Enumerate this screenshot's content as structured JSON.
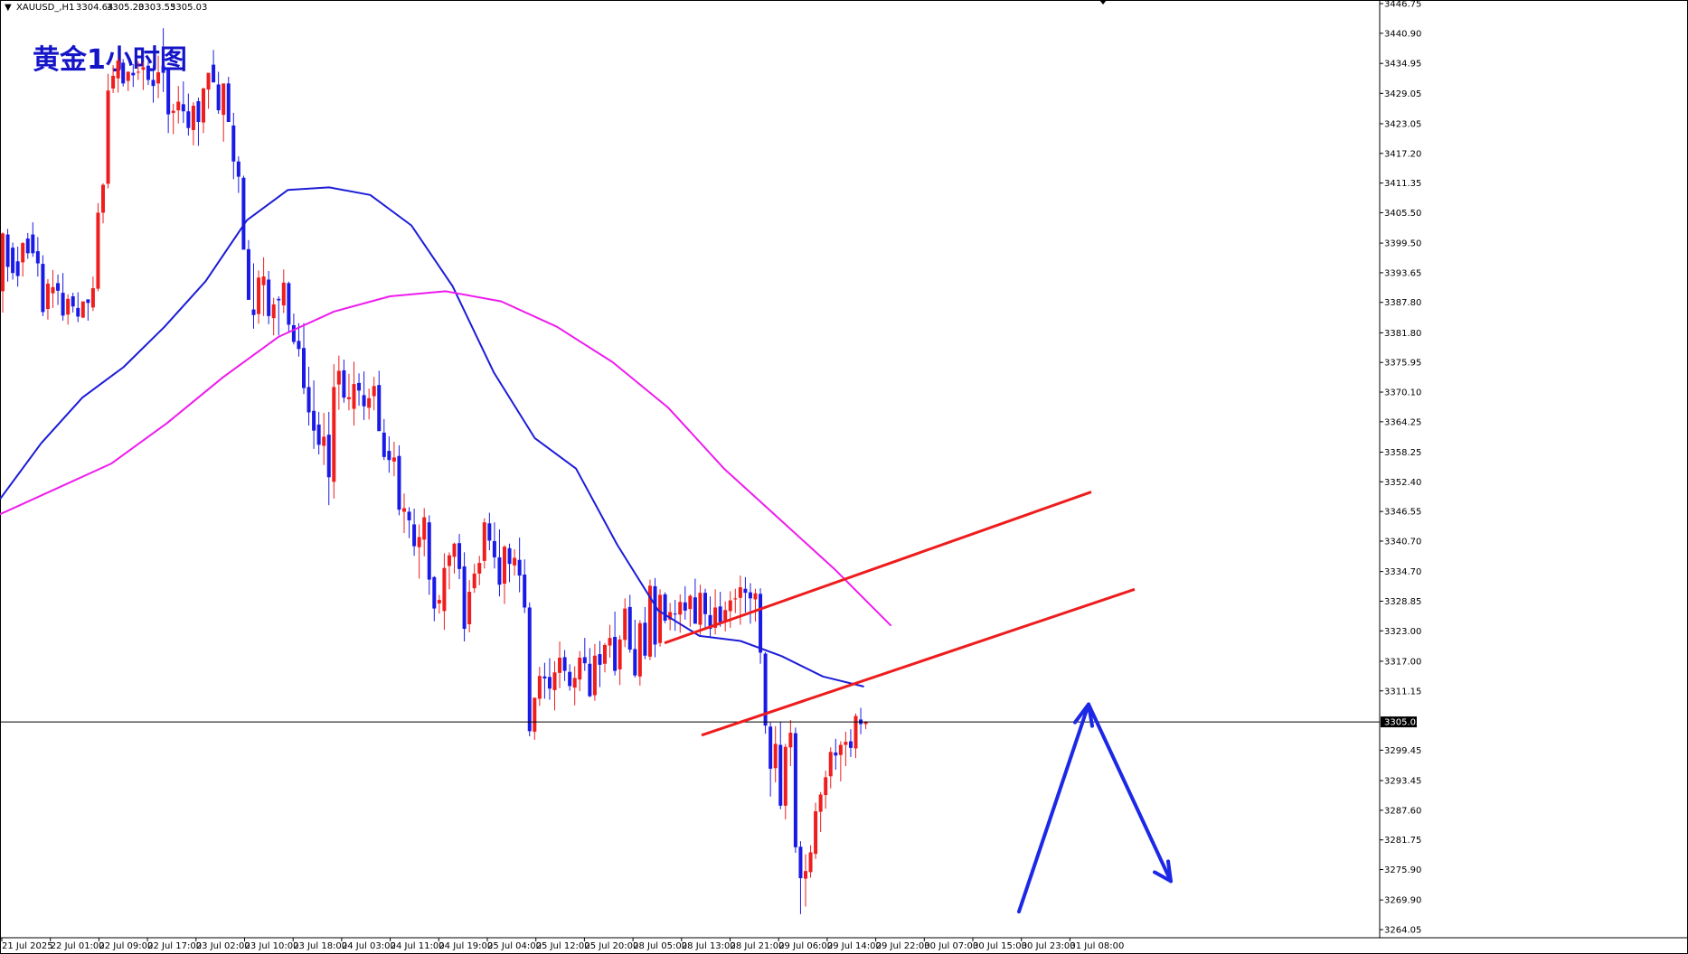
{
  "symbol_info": {
    "symbol": "XAUUSD_,H1",
    "open": "3304.64",
    "high": "3305.20",
    "low": "3303.55",
    "close": "3305.03"
  },
  "overlay_title": "黄金1小时图",
  "current_price_label": "3305.03",
  "colors": {
    "bull": "#ef1d1d",
    "bear": "#1a1ae6",
    "ma_fast": "#1c1cd8",
    "ma_slow": "#ee1cee",
    "channel": "#ee1c1c",
    "projection": "#1c28e6"
  },
  "chart_data": {
    "type": "candlestick",
    "timeframe": "H1",
    "ylim": [
      3264.05,
      3446.75
    ],
    "y_ticks": [
      "3446.75",
      "3440.90",
      "3434.95",
      "3429.05",
      "3423.05",
      "3417.20",
      "3411.35",
      "3405.50",
      "3399.50",
      "3393.65",
      "3387.80",
      "3381.80",
      "3375.95",
      "3370.10",
      "3364.25",
      "3358.25",
      "3352.40",
      "3346.55",
      "3340.70",
      "3334.70",
      "3328.85",
      "3323.00",
      "3317.00",
      "3311.15",
      "3305.03",
      "3299.45",
      "3293.45",
      "3287.60",
      "3281.75",
      "3275.90",
      "3269.90",
      "3264.05"
    ],
    "x_labels": [
      "21 Jul 2025",
      "22 Jul 01:00",
      "22 Jul 09:00",
      "22 Jul 17:00",
      "23 Jul 02:00",
      "23 Jul 10:00",
      "23 Jul 18:00",
      "24 Jul 03:00",
      "24 Jul 11:00",
      "24 Jul 19:00",
      "25 Jul 04:00",
      "25 Jul 12:00",
      "25 Jul 20:00",
      "28 Jul 05:00",
      "28 Jul 13:00",
      "28 Jul 21:00",
      "29 Jul 06:00",
      "29 Jul 14:00",
      "29 Jul 22:00",
      "30 Jul 07:00",
      "30 Jul 15:00",
      "30 Jul 23:00",
      "31 Jul 08:00"
    ],
    "candles": [
      [
        3390.0,
        3401.6,
        3385.8,
        3401.4
      ],
      [
        3401.2,
        3402.3,
        3391.9,
        3394.8
      ],
      [
        3398.6,
        3399.6,
        3392.3,
        3393.6
      ],
      [
        3395.9,
        3398.8,
        3390.9,
        3393.0
      ],
      [
        3395.7,
        3399.7,
        3392.9,
        3399.5
      ],
      [
        3400.4,
        3401.5,
        3396.4,
        3397.5
      ],
      [
        3401.2,
        3403.6,
        3396.8,
        3397.5
      ],
      [
        3397.9,
        3400.7,
        3392.9,
        3395.5
      ],
      [
        3395.4,
        3397.1,
        3385.1,
        3385.9
      ],
      [
        3386.5,
        3392.4,
        3384.4,
        3391.5
      ],
      [
        3389.6,
        3394.2,
        3386.7,
        3390.8
      ],
      [
        3391.6,
        3393.3,
        3387.3,
        3390.1
      ],
      [
        3389.7,
        3393.6,
        3384.2,
        3385.2
      ],
      [
        3385.4,
        3389.4,
        3383.4,
        3388.5
      ],
      [
        3389.0,
        3389.7,
        3385.8,
        3387.0
      ],
      [
        3386.7,
        3389.8,
        3383.9,
        3385.0
      ],
      [
        3384.8,
        3387.8,
        3384.7,
        3388.0
      ],
      [
        3388.4,
        3388.4,
        3384.2,
        3387.7
      ],
      [
        3386.8,
        3392.9,
        3386.1,
        3390.6
      ],
      [
        3390.5,
        3407.4,
        3390.0,
        3405.5
      ],
      [
        3405.5,
        3411.3,
        3403.4,
        3411.0
      ],
      [
        3411.2,
        3432.9,
        3410.3,
        3429.6
      ],
      [
        3430.0,
        3434.6,
        3429.1,
        3432.5
      ],
      [
        3432.0,
        3436.1,
        3429.2,
        3435.5
      ],
      [
        3435.1,
        3435.8,
        3430.4,
        3431.0
      ],
      [
        3431.5,
        3433.4,
        3429.5,
        3433.3
      ],
      [
        3433.1,
        3434.8,
        3430.3,
        3432.6
      ],
      [
        3433.3,
        3435.4,
        3431.7,
        3433.3
      ],
      [
        3433.7,
        3435.2,
        3429.7,
        3434.2
      ],
      [
        3434.5,
        3435.3,
        3430.7,
        3431.7
      ],
      [
        3431.7,
        3434.6,
        3427.2,
        3430.5
      ],
      [
        3431.0,
        3436.5,
        3428.1,
        3433.2
      ],
      [
        3434.5,
        3441.9,
        3429.3,
        3433.1
      ],
      [
        3433.8,
        3434.0,
        3421.2,
        3424.9
      ],
      [
        3425.2,
        3427.0,
        3421.0,
        3425.6
      ],
      [
        3425.7,
        3430.5,
        3423.1,
        3427.4
      ],
      [
        3426.9,
        3431.4,
        3423.2,
        3425.5
      ],
      [
        3425.5,
        3429.0,
        3420.7,
        3422.2
      ],
      [
        3421.8,
        3427.3,
        3418.8,
        3426.6
      ],
      [
        3427.5,
        3428.2,
        3418.7,
        3423.4
      ],
      [
        3423.3,
        3430.2,
        3421.2,
        3430.0
      ],
      [
        3429.8,
        3432.4,
        3426.0,
        3433.1
      ],
      [
        3434.7,
        3437.6,
        3431.5,
        3431.2
      ],
      [
        3430.8,
        3433.3,
        3425.0,
        3425.7
      ],
      [
        3424.8,
        3430.8,
        3419.5,
        3431.0
      ],
      [
        3431.0,
        3432.3,
        3423.6,
        3423.4
      ],
      [
        3422.7,
        3425.2,
        3412.1,
        3415.6
      ],
      [
        3415.6,
        3416.6,
        3409.4,
        3412.6
      ],
      [
        3412.4,
        3412.8,
        3401.2,
        3398.2
      ],
      [
        3398.3,
        3400.1,
        3388.8,
        3388.3
      ],
      [
        3386.4,
        3395.5,
        3382.6,
        3385.3
      ],
      [
        3385.5,
        3394.1,
        3383.6,
        3392.7
      ],
      [
        3391.2,
        3396.7,
        3385.1,
        3392.9
      ],
      [
        3392.3,
        3394.0,
        3383.5,
        3385.1
      ],
      [
        3384.7,
        3388.7,
        3381.3,
        3387.4
      ],
      [
        3388.5,
        3389.0,
        3381.3,
        3388.2
      ],
      [
        3387.2,
        3394.3,
        3385.7,
        3391.7
      ],
      [
        3391.6,
        3391.9,
        3381.8,
        3383.4
      ],
      [
        3383.3,
        3385.6,
        3379.5,
        3380.0
      ],
      [
        3380.2,
        3383.7,
        3377.1,
        3378.6
      ],
      [
        3378.8,
        3383.7,
        3369.7,
        3370.9
      ],
      [
        3371.1,
        3375.1,
        3363.5,
        3366.1
      ],
      [
        3366.4,
        3372.4,
        3358.9,
        3362.5
      ],
      [
        3363.7,
        3366.2,
        3357.8,
        3359.7
      ],
      [
        3359.5,
        3366.0,
        3355.7,
        3361.3
      ],
      [
        3361.7,
        3366.2,
        3347.8,
        3353.3
      ],
      [
        3352.4,
        3375.6,
        3349.1,
        3371.1
      ],
      [
        3371.6,
        3377.3,
        3366.6,
        3374.3
      ],
      [
        3374.4,
        3376.5,
        3368.0,
        3369.0
      ],
      [
        3368.7,
        3373.7,
        3366.5,
        3369.1
      ],
      [
        3366.8,
        3376.1,
        3363.5,
        3371.7
      ],
      [
        3371.9,
        3373.8,
        3367.4,
        3370.4
      ],
      [
        3369.5,
        3374.2,
        3364.6,
        3367.3
      ],
      [
        3367.0,
        3370.8,
        3364.7,
        3368.9
      ],
      [
        3369.3,
        3373.1,
        3366.5,
        3371.3
      ],
      [
        3371.5,
        3374.3,
        3364.5,
        3362.4
      ],
      [
        3362.1,
        3364.8,
        3356.7,
        3357.3
      ],
      [
        3358.5,
        3361.4,
        3354.2,
        3356.7
      ],
      [
        3356.4,
        3360.3,
        3353.5,
        3357.2
      ],
      [
        3357.5,
        3359.6,
        3345.8,
        3346.9
      ],
      [
        3346.5,
        3350.1,
        3342.3,
        3347.2
      ],
      [
        3346.5,
        3347.4,
        3341.3,
        3344.8
      ],
      [
        3344.0,
        3347.1,
        3337.8,
        3339.7
      ],
      [
        3339.5,
        3344.0,
        3333.3,
        3341.5
      ],
      [
        3341.0,
        3347.2,
        3337.7,
        3345.4
      ],
      [
        3344.4,
        3345.8,
        3330.1,
        3333.1
      ],
      [
        3333.6,
        3333.8,
        3324.9,
        3327.4
      ],
      [
        3328.4,
        3330.1,
        3326.4,
        3329.1
      ],
      [
        3326.9,
        3338.3,
        3323.2,
        3335.4
      ],
      [
        3335.8,
        3338.5,
        3331.2,
        3337.9
      ],
      [
        3337.6,
        3340.4,
        3334.3,
        3340.2
      ],
      [
        3340.3,
        3342.1,
        3333.2,
        3335.2
      ],
      [
        3335.7,
        3338.5,
        3320.9,
        3323.4
      ],
      [
        3324.3,
        3333.0,
        3322.7,
        3330.7
      ],
      [
        3331.4,
        3336.2,
        3330.5,
        3334.3
      ],
      [
        3334.3,
        3337.8,
        3332.0,
        3336.4
      ],
      [
        3336.8,
        3345.2,
        3335.3,
        3344.4
      ],
      [
        3344.2,
        3346.3,
        3338.9,
        3340.8
      ],
      [
        3340.7,
        3344.4,
        3335.3,
        3337.5
      ],
      [
        3337.5,
        3343.0,
        3329.8,
        3332.1
      ],
      [
        3332.3,
        3339.9,
        3328.3,
        3339.6
      ],
      [
        3339.3,
        3340.2,
        3332.6,
        3336.2
      ],
      [
        3335.9,
        3339.1,
        3333.9,
        3337.4
      ],
      [
        3337.0,
        3341.4,
        3330.6,
        3333.9
      ],
      [
        3334.1,
        3337.1,
        3326.5,
        3327.6
      ],
      [
        3327.6,
        3328.6,
        3302.2,
        3303.2
      ],
      [
        3303.1,
        3309.8,
        3301.5,
        3309.8
      ],
      [
        3309.6,
        3315.9,
        3308.2,
        3314.1
      ],
      [
        3314.0,
        3316.7,
        3309.6,
        3313.6
      ],
      [
        3313.9,
        3317.6,
        3309.4,
        3311.6
      ],
      [
        3311.3,
        3317.0,
        3307.3,
        3314.8
      ],
      [
        3314.7,
        3320.9,
        3311.7,
        3317.7
      ],
      [
        3317.8,
        3319.2,
        3313.1,
        3315.1
      ],
      [
        3314.9,
        3316.4,
        3311.2,
        3312.1
      ],
      [
        3311.8,
        3316.0,
        3308.3,
        3313.7
      ],
      [
        3313.4,
        3319.0,
        3311.1,
        3317.7
      ],
      [
        3317.8,
        3321.6,
        3315.1,
        3316.6
      ],
      [
        3316.5,
        3319.6,
        3309.9,
        3310.1
      ],
      [
        3310.3,
        3320.4,
        3309.2,
        3318.1
      ],
      [
        3318.4,
        3321.0,
        3311.9,
        3316.3
      ],
      [
        3316.5,
        3320.6,
        3314.8,
        3320.2
      ],
      [
        3320.1,
        3324.2,
        3317.7,
        3321.6
      ],
      [
        3321.8,
        3326.8,
        3314.2,
        3315.1
      ],
      [
        3315.4,
        3322.1,
        3312.3,
        3321.3
      ],
      [
        3321.2,
        3329.4,
        3319.8,
        3327.4
      ],
      [
        3327.7,
        3330.1,
        3318.7,
        3319.3
      ],
      [
        3319.4,
        3325.2,
        3313.8,
        3314.2
      ],
      [
        3314.0,
        3325.1,
        3312.2,
        3324.5
      ],
      [
        3324.6,
        3327.7,
        3317.4,
        3318.1
      ],
      [
        3317.9,
        3333.1,
        3317.2,
        3331.9
      ],
      [
        3331.8,
        3333.4,
        3317.8,
        3320.3
      ],
      [
        3320.6,
        3331.2,
        3319.9,
        3330.1
      ],
      [
        3330.2,
        3330.6,
        3324.5,
        3325.0
      ],
      [
        3325.2,
        3328.5,
        3323.1,
        3326.7
      ],
      [
        3326.4,
        3329.1,
        3323.0,
        3326.3
      ],
      [
        3326.2,
        3330.2,
        3322.6,
        3328.7
      ],
      [
        3328.6,
        3331.8,
        3325.2,
        3327.0
      ],
      [
        3327.3,
        3330.2,
        3323.8,
        3329.9
      ],
      [
        3329.6,
        3333.3,
        3325.1,
        3324.4
      ],
      [
        3324.2,
        3332.1,
        3322.2,
        3330.5
      ],
      [
        3330.5,
        3331.3,
        3323.4,
        3326.3
      ],
      [
        3326.1,
        3329.8,
        3321.8,
        3323.4
      ],
      [
        3323.6,
        3331.2,
        3322.3,
        3327.6
      ],
      [
        3327.8,
        3330.7,
        3323.8,
        3324.7
      ],
      [
        3324.8,
        3328.8,
        3322.9,
        3327.1
      ],
      [
        3326.9,
        3330.8,
        3323.6,
        3329.0
      ],
      [
        3329.2,
        3331.3,
        3326.5,
        3329.4
      ],
      [
        3329.5,
        3333.9,
        3324.2,
        3331.6
      ],
      [
        3331.3,
        3333.6,
        3326.6,
        3330.5
      ],
      [
        3330.6,
        3332.4,
        3324.4,
        3329.4
      ],
      [
        3329.2,
        3331.3,
        3324.8,
        3330.4
      ],
      [
        3330.3,
        3331.4,
        3316.5,
        3318.7
      ],
      [
        3318.5,
        3318.8,
        3302.7,
        3304.3
      ],
      [
        3304.1,
        3304.9,
        3290.3,
        3295.8
      ],
      [
        3295.9,
        3304.2,
        3293.1,
        3300.7
      ],
      [
        3300.5,
        3305.1,
        3287.8,
        3288.5
      ],
      [
        3288.5,
        3300.7,
        3285.8,
        3300.1
      ],
      [
        3300.0,
        3305.4,
        3296.3,
        3302.9
      ],
      [
        3302.8,
        3303.9,
        3279.2,
        3280.3
      ],
      [
        3280.4,
        3281.5,
        3267.1,
        3274.2
      ],
      [
        3274.1,
        3278.9,
        3268.6,
        3275.6
      ],
      [
        3275.4,
        3280.7,
        3274.3,
        3279.3
      ],
      [
        3279.0,
        3289.1,
        3278.0,
        3287.4
      ],
      [
        3287.3,
        3291.2,
        3283.3,
        3290.7
      ],
      [
        3290.6,
        3295.4,
        3287.9,
        3294.1
      ],
      [
        3294.3,
        3300.0,
        3291.9,
        3299.1
      ],
      [
        3299.0,
        3301.7,
        3295.6,
        3298.4
      ],
      [
        3298.5,
        3301.2,
        3293.3,
        3300.5
      ],
      [
        3300.5,
        3303.1,
        3296.3,
        3301.1
      ],
      [
        3301.2,
        3303.6,
        3298.1,
        3299.9
      ],
      [
        3299.8,
        3306.7,
        3297.9,
        3306.2
      ],
      [
        3305.5,
        3307.8,
        3302.6,
        3304.6
      ],
      [
        3304.6,
        3305.2,
        3303.6,
        3305.0
      ]
    ],
    "series": [
      {
        "name": "",
        "color": "#1c1cd8",
        "values": [
          3349.0,
          3360,
          3369,
          3375,
          3383,
          3392,
          3404,
          3410,
          3410.5,
          3409,
          3403,
          3391,
          3374,
          3361,
          3355,
          3340,
          3327,
          3322,
          3321,
          3318,
          3314,
          3312
        ]
      },
      {
        "name": "",
        "color": "#ee1cee",
        "values": [
          3346.0,
          3351,
          3356,
          3364,
          3373,
          3381,
          3386,
          3389,
          3390,
          3388,
          3383,
          3376,
          3367,
          3355,
          3345,
          3335,
          3324
        ]
      }
    ],
    "channel_lines": [
      {
        "from": [
          3320.6,
          "28 Jul 13:00"
        ],
        "to": [
          3350.4,
          "31 Jul 08:00"
        ]
      },
      {
        "from": [
          3302.4,
          "28 Jul 13:00"
        ],
        "to": [
          3331.2,
          "31 Jul 08:00"
        ]
      }
    ],
    "projection_arrows": [
      {
        "from": 3267.6,
        "to": 3308.5
      },
      {
        "from": 3308.5,
        "to": 3273.6
      }
    ],
    "horizontal_line": 3305.03
  }
}
